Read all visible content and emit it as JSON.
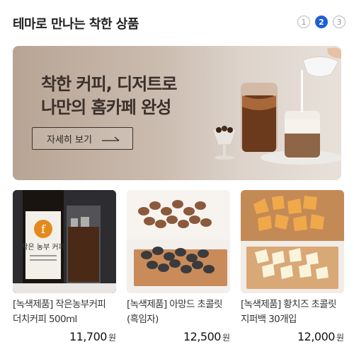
{
  "section": {
    "title": "테마로 만나는 착한 상품"
  },
  "pagination": {
    "pages": [
      "1",
      "2",
      "3"
    ],
    "active_index": 1
  },
  "banner": {
    "title_line1": "착한 커피, 디저트로",
    "title_line2": "나만의 홈카페 완성",
    "button_label": "자세히 보기"
  },
  "products": [
    {
      "name": "[녹색제품] 작은농부커피 더치커피 500ml",
      "price": "11,700",
      "currency": "원",
      "label_text": "작은 농부 커피"
    },
    {
      "name": "[녹색제품] 아망드 초콜릿 (흑임자)",
      "price": "12,500",
      "currency": "원"
    },
    {
      "name": "[녹색제품] 황치즈 초콜릿 지퍼백 30개입",
      "price": "12,000",
      "currency": "원"
    }
  ],
  "colors": {
    "accent": "#1f5fd6",
    "banner_bg": "#cbbcb0"
  },
  "icons": {
    "banner_button": "long-right-arrow-icon"
  }
}
